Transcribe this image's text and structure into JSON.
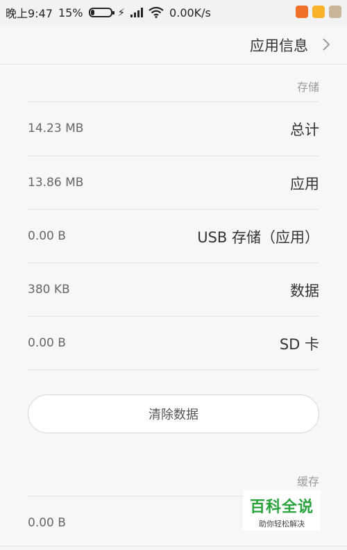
{
  "status_bar": {
    "time": "晚上9:47",
    "battery": "15%",
    "network_speed": "0.00K/s"
  },
  "header": {
    "title": "应用信息"
  },
  "storage": {
    "section_title": "存储",
    "rows": [
      {
        "value": "14.23 MB",
        "label": "总计"
      },
      {
        "value": "13.86 MB",
        "label": "应用"
      },
      {
        "value": "0.00 B",
        "label": "USB 存储（应用）"
      },
      {
        "value": "380 KB",
        "label": "数据"
      },
      {
        "value": "0.00 B",
        "label": "SD 卡"
      }
    ],
    "clear_button": "清除数据"
  },
  "cache": {
    "section_title": "缓存",
    "rows": [
      {
        "value": "0.00 B",
        "label": ""
      }
    ]
  },
  "watermark": {
    "title": "百科全说",
    "subtitle": "助你轻松解决"
  }
}
